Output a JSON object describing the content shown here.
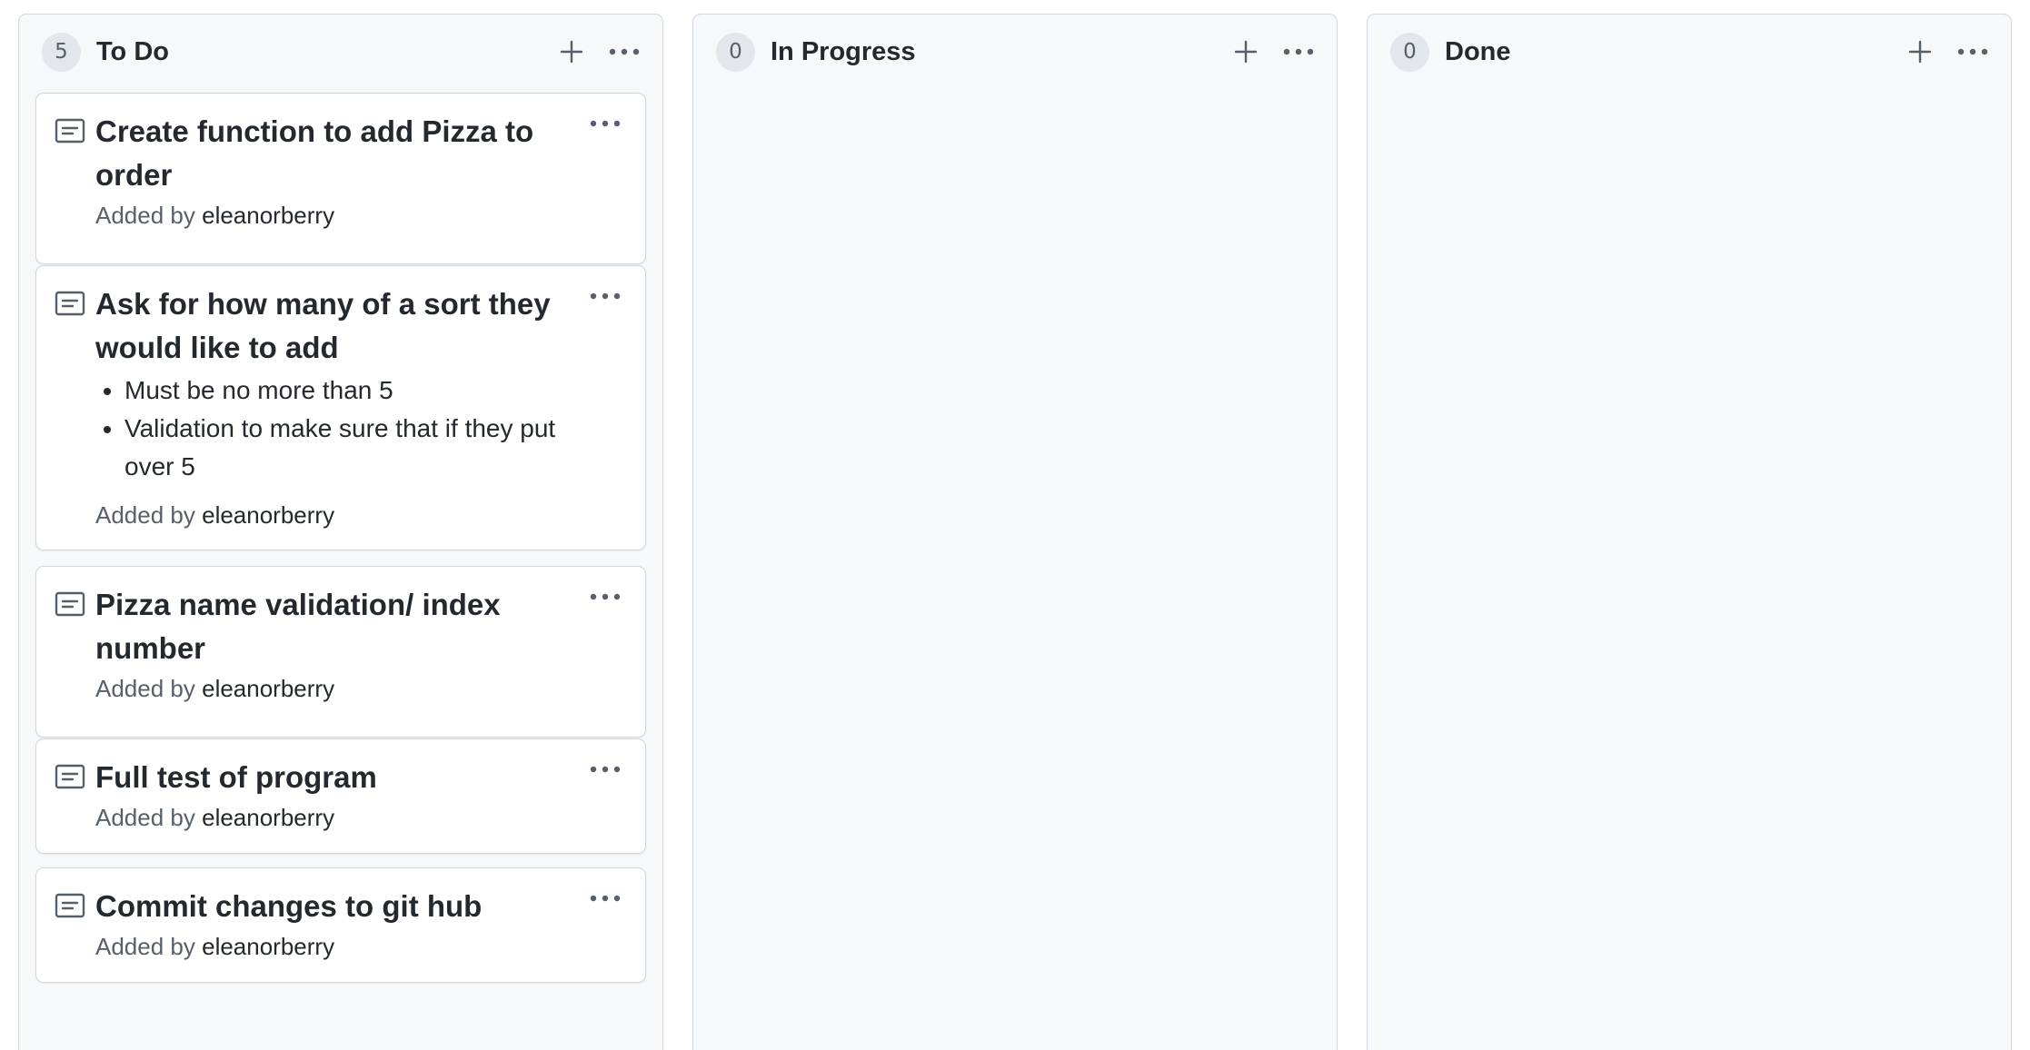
{
  "columns": [
    {
      "title": "To Do",
      "count": "5",
      "cards": [
        {
          "title": "Create function to add Pizza to order",
          "bullets": [],
          "added_by_label": "Added by",
          "author": "eleanorberry"
        },
        {
          "title": "Ask for how many of a sort they would like to add",
          "bullets": [
            "Must be no more than 5",
            "Validation to make sure that if they put over 5"
          ],
          "added_by_label": "Added by",
          "author": "eleanorberry"
        },
        {
          "title": "Pizza name validation/ index number",
          "bullets": [],
          "added_by_label": "Added by",
          "author": "eleanorberry"
        },
        {
          "title": "Full test of program",
          "bullets": [],
          "added_by_label": "Added by",
          "author": "eleanorberry"
        },
        {
          "title": "Commit changes to git hub",
          "bullets": [],
          "added_by_label": "Added by",
          "author": "eleanorberry"
        }
      ]
    },
    {
      "title": "In Progress",
      "count": "0",
      "cards": []
    },
    {
      "title": "Done",
      "count": "0",
      "cards": []
    }
  ],
  "icons": {
    "add": "plus-icon",
    "menu": "kebab-horizontal-icon",
    "note": "note-icon"
  }
}
